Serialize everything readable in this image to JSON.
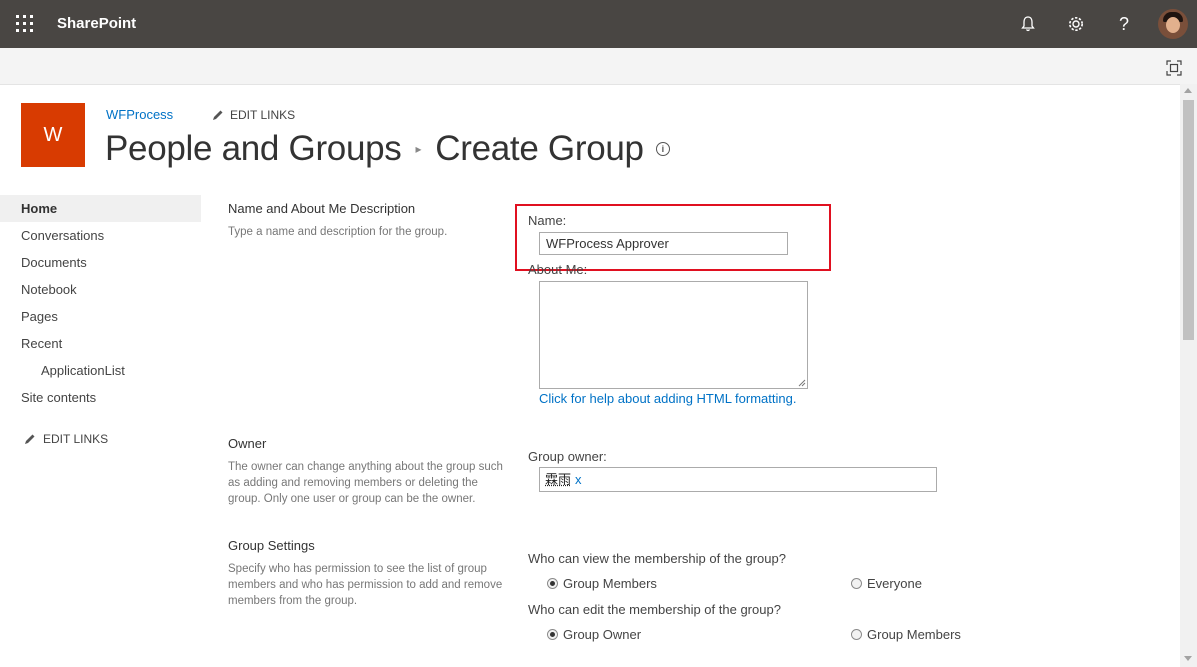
{
  "suitebar": {
    "brand": "SharePoint",
    "icons": [
      "app-launcher-icon",
      "bell-icon",
      "gear-icon",
      "help-icon",
      "avatar"
    ]
  },
  "site": {
    "logo_letter": "W",
    "name": "WFProcess",
    "edit_links": "EDIT LINKS",
    "title_parent": "People and Groups",
    "title_current": "Create Group",
    "logo_color": "#d83b01"
  },
  "nav": {
    "items": [
      {
        "label": "Home",
        "active": true
      },
      {
        "label": "Conversations"
      },
      {
        "label": "Documents"
      },
      {
        "label": "Notebook"
      },
      {
        "label": "Pages"
      },
      {
        "label": "Recent"
      },
      {
        "label": "ApplicationList",
        "sub": true
      },
      {
        "label": "Site contents"
      }
    ],
    "edit_links": "EDIT LINKS"
  },
  "sections": {
    "name": {
      "title": "Name and About Me Description",
      "desc": "Type a name and description for the group.",
      "name_label": "Name:",
      "name_value": "WFProcess Approver",
      "about_label": "About Me:",
      "help_link": "Click for help about adding HTML formatting."
    },
    "owner": {
      "title": "Owner",
      "desc": "The owner can change anything about the group such as adding and removing members or deleting the group. Only one user or group can be the owner.",
      "label": "Group owner:",
      "value": "霖雨",
      "remove": "x"
    },
    "settings": {
      "title": "Group Settings",
      "desc": "Specify who has permission to see the list of group members and who has permission to add and remove members from the group.",
      "view_question": "Who can view the membership of the group?",
      "view_options": [
        "Group Members",
        "Everyone"
      ],
      "view_selected": "Group Members",
      "edit_question": "Who can edit the membership of the group?",
      "edit_options": [
        "Group Owner",
        "Group Members"
      ],
      "edit_selected": "Group Owner"
    }
  },
  "colors": {
    "suitebar": "#494643",
    "link": "#0072c6",
    "highlight": "#e01020"
  }
}
